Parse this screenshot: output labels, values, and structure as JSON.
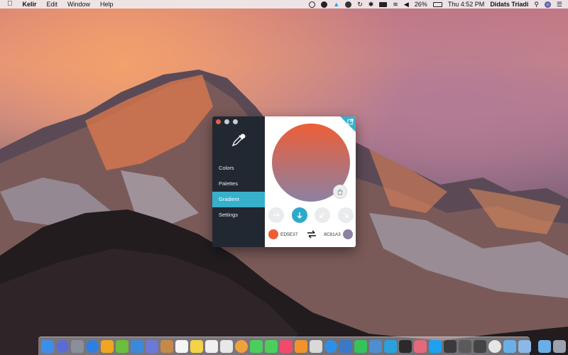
{
  "menubar": {
    "app_name": "Kelir",
    "menus": [
      "Edit",
      "Window",
      "Help"
    ],
    "battery": "26%",
    "clock": "Thu 4:52 PM",
    "user": "Didats Triadi"
  },
  "sidebar": {
    "items": [
      {
        "label": "Colors"
      },
      {
        "label": "Palettes"
      },
      {
        "label": "Gradient"
      },
      {
        "label": "Settings"
      }
    ],
    "active": "Gradient"
  },
  "gradient": {
    "direction": "down",
    "start_color": {
      "hex": "ED5E37",
      "value": "#ED5E37"
    },
    "end_color": {
      "hex": "8C81A3",
      "value": "#8C81A3"
    }
  },
  "colors": {
    "accent": "#37b0cb",
    "sidebar_bg": "#222831"
  },
  "dock": {
    "icons": [
      "finder-icon",
      "siri-icon",
      "launchpad-icon",
      "safari-icon",
      "sketch-icon",
      "evernote-icon",
      "xcode-icon",
      "photo-browser-icon",
      "notefile-icon",
      "calendar-icon",
      "notes-icon",
      "reminders-icon",
      "tasks-icon",
      "photos-icon",
      "messages-icon",
      "facetime-icon",
      "music-icon",
      "books-icon",
      "transmit-icon",
      "app-store-icon",
      "simulator-icon",
      "whatsapp-icon",
      "sqlite-icon",
      "telegram-icon",
      "terminal-icon",
      "kelir-icon",
      "twitter-icon",
      "slack-icon",
      "network-icon",
      "activity-icon",
      "color-picker-icon",
      "preview-icon",
      "cloudapp-icon",
      "folder-icon",
      "trash-icon"
    ]
  }
}
